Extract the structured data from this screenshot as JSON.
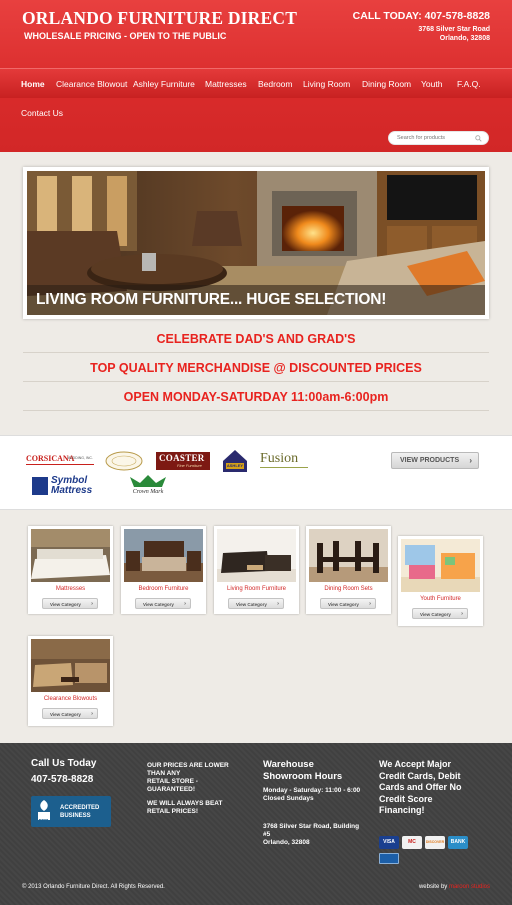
{
  "header": {
    "brand": "ORLANDO FURNITURE DIRECT",
    "tagline": "WHOLESALE PRICING - OPEN TO THE PUBLIC",
    "call_today": "CALL TODAY: 407-578-8828",
    "address_line1": "3768 Silver Star Road",
    "address_line2": "Orlando, 32808"
  },
  "nav": {
    "items": [
      "Home",
      "Clearance Blowout",
      "Ashley Furniture",
      "Mattresses",
      "Bedroom",
      "Living Room",
      "Dining Room",
      "Youth",
      "F.A.Q.",
      "Contact Us"
    ],
    "active": "Home"
  },
  "search": {
    "placeholder": "Search for products"
  },
  "hero": {
    "caption": "LIVING ROOM FURNITURE... HUGE SELECTION!"
  },
  "promos": [
    "CELEBRATE DAD'S AND GRAD'S",
    "TOP QUALITY MERCHANDISE @ DISCOUNTED PRICES",
    "OPEN MONDAY-SATURDAY 11:00am-6:00pm"
  ],
  "brands": {
    "corsicana": "CORSICANA",
    "corsicana_sub": "BEDDING, INC.",
    "coaster": "COASTER",
    "coaster_sub": "Fine Furniture",
    "ashley": "ASHLEY",
    "fusion": "Fusion",
    "symbol_top": "Symbol",
    "symbol_bottom": "Mattress",
    "crown_mark": "Crown Mark",
    "view_products": "VIEW PRODUCTS"
  },
  "categories": [
    {
      "title": "Mattresses",
      "button": "View Category"
    },
    {
      "title": "Bedroom Furniture",
      "button": "View Category"
    },
    {
      "title": "Living Room Furniture",
      "button": "View Category"
    },
    {
      "title": "Dining Room Sets",
      "button": "View Category"
    },
    {
      "title": "Youth Furniture",
      "button": "View Category"
    },
    {
      "title": "Clearance Blowouts",
      "button": "View Category"
    }
  ],
  "footer": {
    "call_heading": "Call Us Today",
    "phone": "407-578-8828",
    "bbb_line1": "ACCREDITED",
    "bbb_line2": "BUSINESS",
    "bbb_mark": "BBB",
    "prices_line1": "OUR PRICES ARE LOWER THAN ANY",
    "prices_line2": "RETAIL STORE - GUARANTEED!",
    "prices_line3": "WE WILL ALWAYS BEAT RETAIL PRICES!",
    "hours_heading": "Warehouse Showroom Hours",
    "hours_text": "Monday - Saturday: 11:00 - 6:00",
    "hours_closed": "Closed Sundays",
    "address_text": "3768 Silver Star Road, Building #5",
    "address_city": "Orlando, 32808",
    "credit_heading": "We Accept Major Credit Cards, Debit Cards and Offer No Credit Score Financing!",
    "cards": [
      "VISA",
      "MC",
      "DISCOVER",
      "BANK"
    ],
    "copyright": "© 2013 Orlando Furniture Direct. All Rights Reserved.",
    "website_by": "website by",
    "website_by_name": "maroon studios"
  },
  "colors": {
    "brand_red": "#d92b2b",
    "promo_red": "#e8231f",
    "footer_bg": "#424242"
  }
}
